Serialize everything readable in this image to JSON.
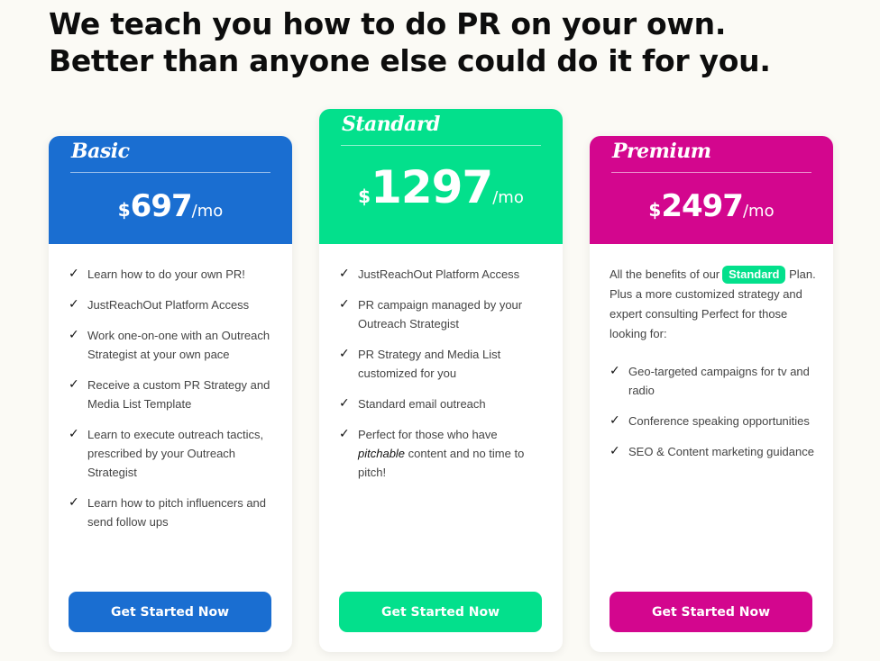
{
  "headline": {
    "line1": "We teach you how to do PR on your own.",
    "line2": "Better than anyone else could do it for you."
  },
  "colors": {
    "basic": "#1a6ed1",
    "standard": "#03e08c",
    "premium": "#d3068e"
  },
  "plans": [
    {
      "name": "Basic",
      "currency": "$",
      "amount": "697",
      "period": "/mo",
      "features": [
        "Learn how to do your own PR!",
        "JustReachOut Platform Access",
        "Work one-on-one with an Outreach Strategist at your own pace",
        "Receive a custom PR Strategy and Media List Template",
        "Learn to execute outreach tactics, prescribed by your Outreach Strategist",
        "Learn how to pitch influencers and send follow ups"
      ],
      "cta": "Get Started Now"
    },
    {
      "name": "Standard",
      "currency": "$",
      "amount": "1297",
      "period": "/mo",
      "features": [
        "JustReachOut Platform Access",
        "PR campaign managed by your Outreach Strategist",
        "PR Strategy and Media List customized for you",
        "Standard email outreach"
      ],
      "last_feature": {
        "before": "Perfect for those who have ",
        "emphasis": "pitchable",
        "after": " content and no time to pitch!"
      },
      "cta": "Get Started Now"
    },
    {
      "name": "Premium",
      "currency": "$",
      "amount": "2497",
      "period": "/mo",
      "intro_before": "All the benefits of our",
      "intro_badge": "Standard",
      "intro_after": "Plan. Plus a more customized strategy and expert consulting Perfect for those looking for:",
      "features": [
        "Geo-targeted campaigns for tv and radio",
        "Conference speaking opportunities",
        "SEO & Content marketing guidance"
      ],
      "cta": "Get Started Now"
    }
  ]
}
